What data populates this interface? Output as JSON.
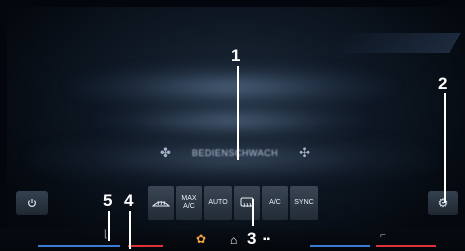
{
  "display": {
    "fan_label": "BEDIENSCHWACH",
    "left_fan_icon": "fan-icon",
    "right_fan_icon": "fan-icon"
  },
  "callouts": [
    {
      "label": "1"
    },
    {
      "label": "2"
    },
    {
      "label": "3"
    },
    {
      "label": "4"
    },
    {
      "label": "5"
    }
  ],
  "buttons": {
    "power_icon": "power-icon",
    "settings_icon": "settings-gear-icon",
    "windshield_icon": "windshield-defrost-icon",
    "max_ac_label": "MAX\nA/C",
    "auto_label": "AUTO",
    "rear_defrost_icon": "rear-defrost-icon",
    "ac_label": "A/C",
    "sync_label": "SYNC"
  },
  "bottom_bar": {
    "fan_icon": "fan-icon",
    "home_icon": "home-icon",
    "grid_icon": "grid-icon",
    "left_seat_icon": "seat-icon",
    "right_seat_icon": "seat-icon"
  },
  "colors": {
    "accent_red": "#e0303a",
    "accent_blue": "#3a7bd5",
    "background": "#05090f"
  }
}
